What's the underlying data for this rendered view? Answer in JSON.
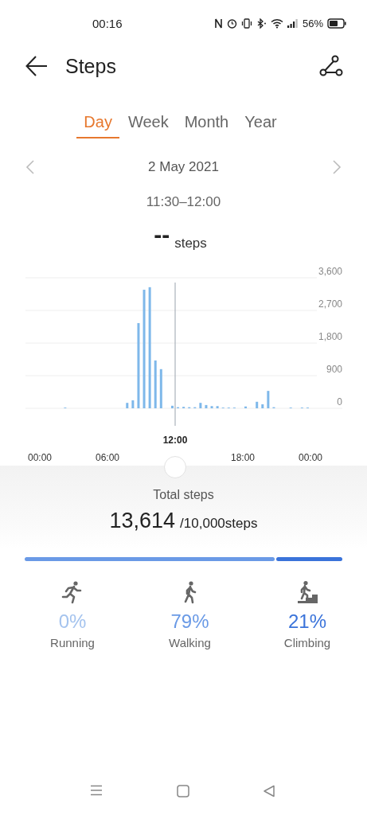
{
  "status_bar": {
    "time": "00:16",
    "battery": "56%"
  },
  "header": {
    "title": "Steps"
  },
  "tabs": [
    {
      "label": "Day",
      "selected": true
    },
    {
      "label": "Week",
      "selected": false
    },
    {
      "label": "Month",
      "selected": false
    },
    {
      "label": "Year",
      "selected": false
    }
  ],
  "date": "2 May 2021",
  "time_range": "11:30–12:00",
  "reading": {
    "value": "--",
    "unit": "steps"
  },
  "chart_data": {
    "type": "bar",
    "x": [
      0,
      0.5,
      1,
      1.5,
      2,
      2.5,
      3,
      3.5,
      4,
      4.5,
      5,
      5.5,
      6,
      6.5,
      7,
      7.5,
      8,
      8.5,
      9,
      9.5,
      10,
      10.5,
      11,
      11.5,
      12,
      12.5,
      13,
      13.5,
      14,
      14.5,
      15,
      15.5,
      16,
      16.5,
      17,
      17.5,
      18,
      18.5,
      19,
      19.5,
      20,
      20.5,
      21,
      21.5,
      22,
      22.5,
      23,
      23.5
    ],
    "series": [
      {
        "color": "#7eb8ea",
        "values": [
          0,
          0,
          0,
          0,
          20,
          0,
          0,
          0,
          0,
          0,
          0,
          0,
          0,
          0,
          0,
          150,
          220,
          2350,
          3270,
          3340,
          1320,
          1080,
          0,
          70,
          30,
          40,
          30,
          30,
          150,
          90,
          60,
          60,
          20,
          20,
          20,
          0,
          50,
          0,
          180,
          110,
          480,
          30,
          0,
          0,
          20,
          0,
          20,
          20
        ]
      }
    ],
    "xlim": [
      0,
      24
    ],
    "ylim": [
      0,
      3600
    ],
    "grid": true,
    "yticks": [
      {
        "value": 0,
        "label": "0"
      },
      {
        "value": 900,
        "label": "900"
      },
      {
        "value": 1800,
        "label": "1,800"
      },
      {
        "value": 2700,
        "label": "2,700"
      },
      {
        "value": 3600,
        "label": "3,600"
      }
    ],
    "xticks": [
      {
        "value": 0,
        "label": "00:00"
      },
      {
        "value": 6,
        "label": "06:00"
      },
      {
        "value": 18,
        "label": "18:00"
      },
      {
        "value": 24,
        "label": "00:00"
      }
    ],
    "ref_lines": [
      {
        "axis": "x",
        "value": 12
      }
    ],
    "annotations": [
      "12:00"
    ]
  },
  "total": {
    "label": "Total steps",
    "value": "13,614",
    "goal": "/10,000steps"
  },
  "activities": [
    {
      "kind": "running",
      "percent": "0%",
      "label": "Running",
      "color": "#a4c3ee"
    },
    {
      "kind": "walking",
      "percent": "79%",
      "label": "Walking",
      "color": "#6a9ae6"
    },
    {
      "kind": "climbing",
      "percent": "21%",
      "label": "Climbing",
      "color": "#3a73da"
    }
  ]
}
